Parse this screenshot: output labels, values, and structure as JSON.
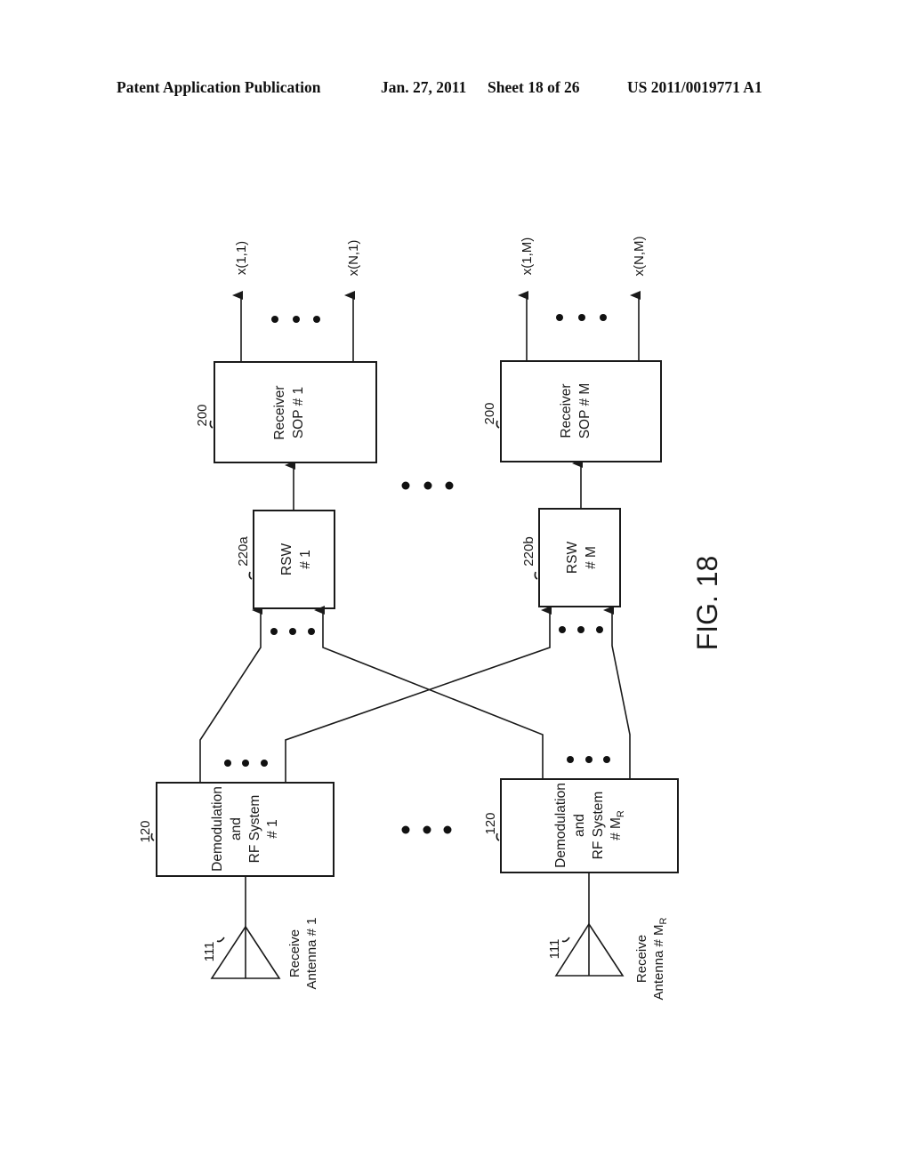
{
  "header": {
    "publication": "Patent Application Publication",
    "date": "Jan. 27, 2011",
    "sheet": "Sheet 18 of 26",
    "number": "US 2011/0019771 A1"
  },
  "figure": {
    "label": "FIG. 18",
    "antennas": [
      {
        "ref": "111",
        "line1": "Receive",
        "line2": "Antenna # 1"
      },
      {
        "ref": "111",
        "line1": "Receive",
        "line2": "Antenna # M",
        "sub": "R"
      }
    ],
    "demod": [
      {
        "ref": "120",
        "line1": "Demodulation",
        "line2": "and",
        "line3": "RF System",
        "line4": "# 1",
        "sub": ""
      },
      {
        "ref": "120",
        "line1": "Demodulation",
        "line2": "and",
        "line3": "RF System",
        "line4": "# M",
        "sub": "R"
      }
    ],
    "rsw": [
      {
        "ref": "220a",
        "line1": "RSW",
        "line2": "# 1"
      },
      {
        "ref": "220b",
        "line1": "RSW",
        "line2": "# M"
      }
    ],
    "receivers": [
      {
        "ref": "200",
        "line1": "Receiver",
        "line2": "SOP # 1"
      },
      {
        "ref": "200",
        "line1": "Receiver",
        "line2": "SOP # M"
      }
    ],
    "outputs": [
      "x(1,1)",
      "x(N,1)",
      "x(1,M)",
      "x(N,M)"
    ],
    "ellipsis": "• • •"
  }
}
